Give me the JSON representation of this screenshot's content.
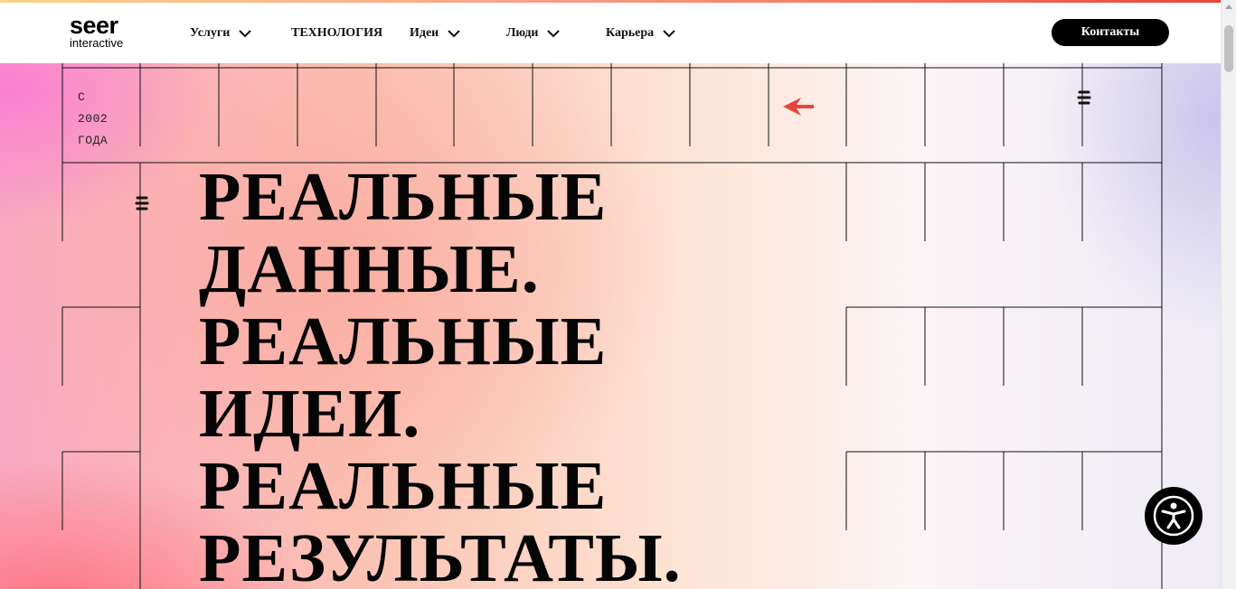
{
  "header": {
    "logo": {
      "top": "seer",
      "bottom": "interactive"
    },
    "nav": [
      {
        "label": "Услуги",
        "has_dropdown": true
      },
      {
        "label": "ТЕХНОЛОГИЯ",
        "has_dropdown": false
      },
      {
        "label": "Идеи",
        "has_dropdown": true
      },
      {
        "label": "Люди",
        "has_dropdown": true
      },
      {
        "label": "Карьера",
        "has_dropdown": true
      }
    ],
    "contact_label": "Контакты"
  },
  "hero": {
    "since": [
      "С",
      "2002",
      "ГОДА"
    ],
    "headline": [
      "РЕАЛЬНЫЕ",
      "ДАННЫЕ.",
      "РЕАЛЬНЫЕ",
      "ИДЕИ.",
      "РЕАЛЬНЫЕ",
      "РЕЗУЛЬТАТЫ."
    ]
  },
  "icons": {
    "nav_chevron": "chevron-down-icon",
    "hero_arrow": "arrow-left-icon",
    "brand_mark": "seer-s-mark-icon",
    "accessibility": "accessibility-icon",
    "corner": "arrow-icon"
  },
  "colors": {
    "accent": "#e5463c",
    "text": "#050505",
    "button_bg": "#000000",
    "button_text": "#ffffff"
  }
}
